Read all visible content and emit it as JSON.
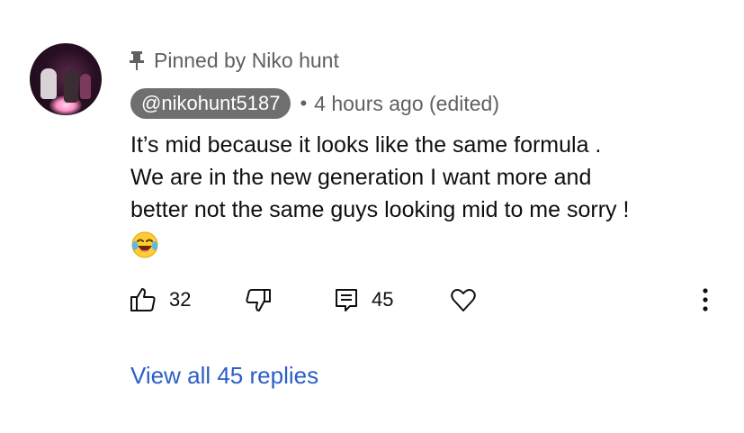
{
  "comment": {
    "pinned_text": "Pinned by Niko hunt",
    "author_handle": "@nikohunt5187",
    "separator": "•",
    "timestamp": "4 hours ago (edited)",
    "body_lines": [
      "It’s mid because it looks like the same formula .",
      "We are in the new generation I want more and",
      "better not the same guys looking mid to me sorry !"
    ],
    "emoji": "laughing-tears-emoji",
    "actions": {
      "like_count": "32",
      "reply_count": "45"
    },
    "view_replies_label": "View all 45 replies"
  },
  "icons": [
    "pin-icon",
    "thumbs-up-icon",
    "thumbs-down-icon",
    "reply-icon",
    "heart-icon",
    "more-vertical-icon"
  ],
  "colors": {
    "handle_bg": "#6f6f6f",
    "secondary_text": "#606060",
    "link": "#2b5fc7"
  }
}
